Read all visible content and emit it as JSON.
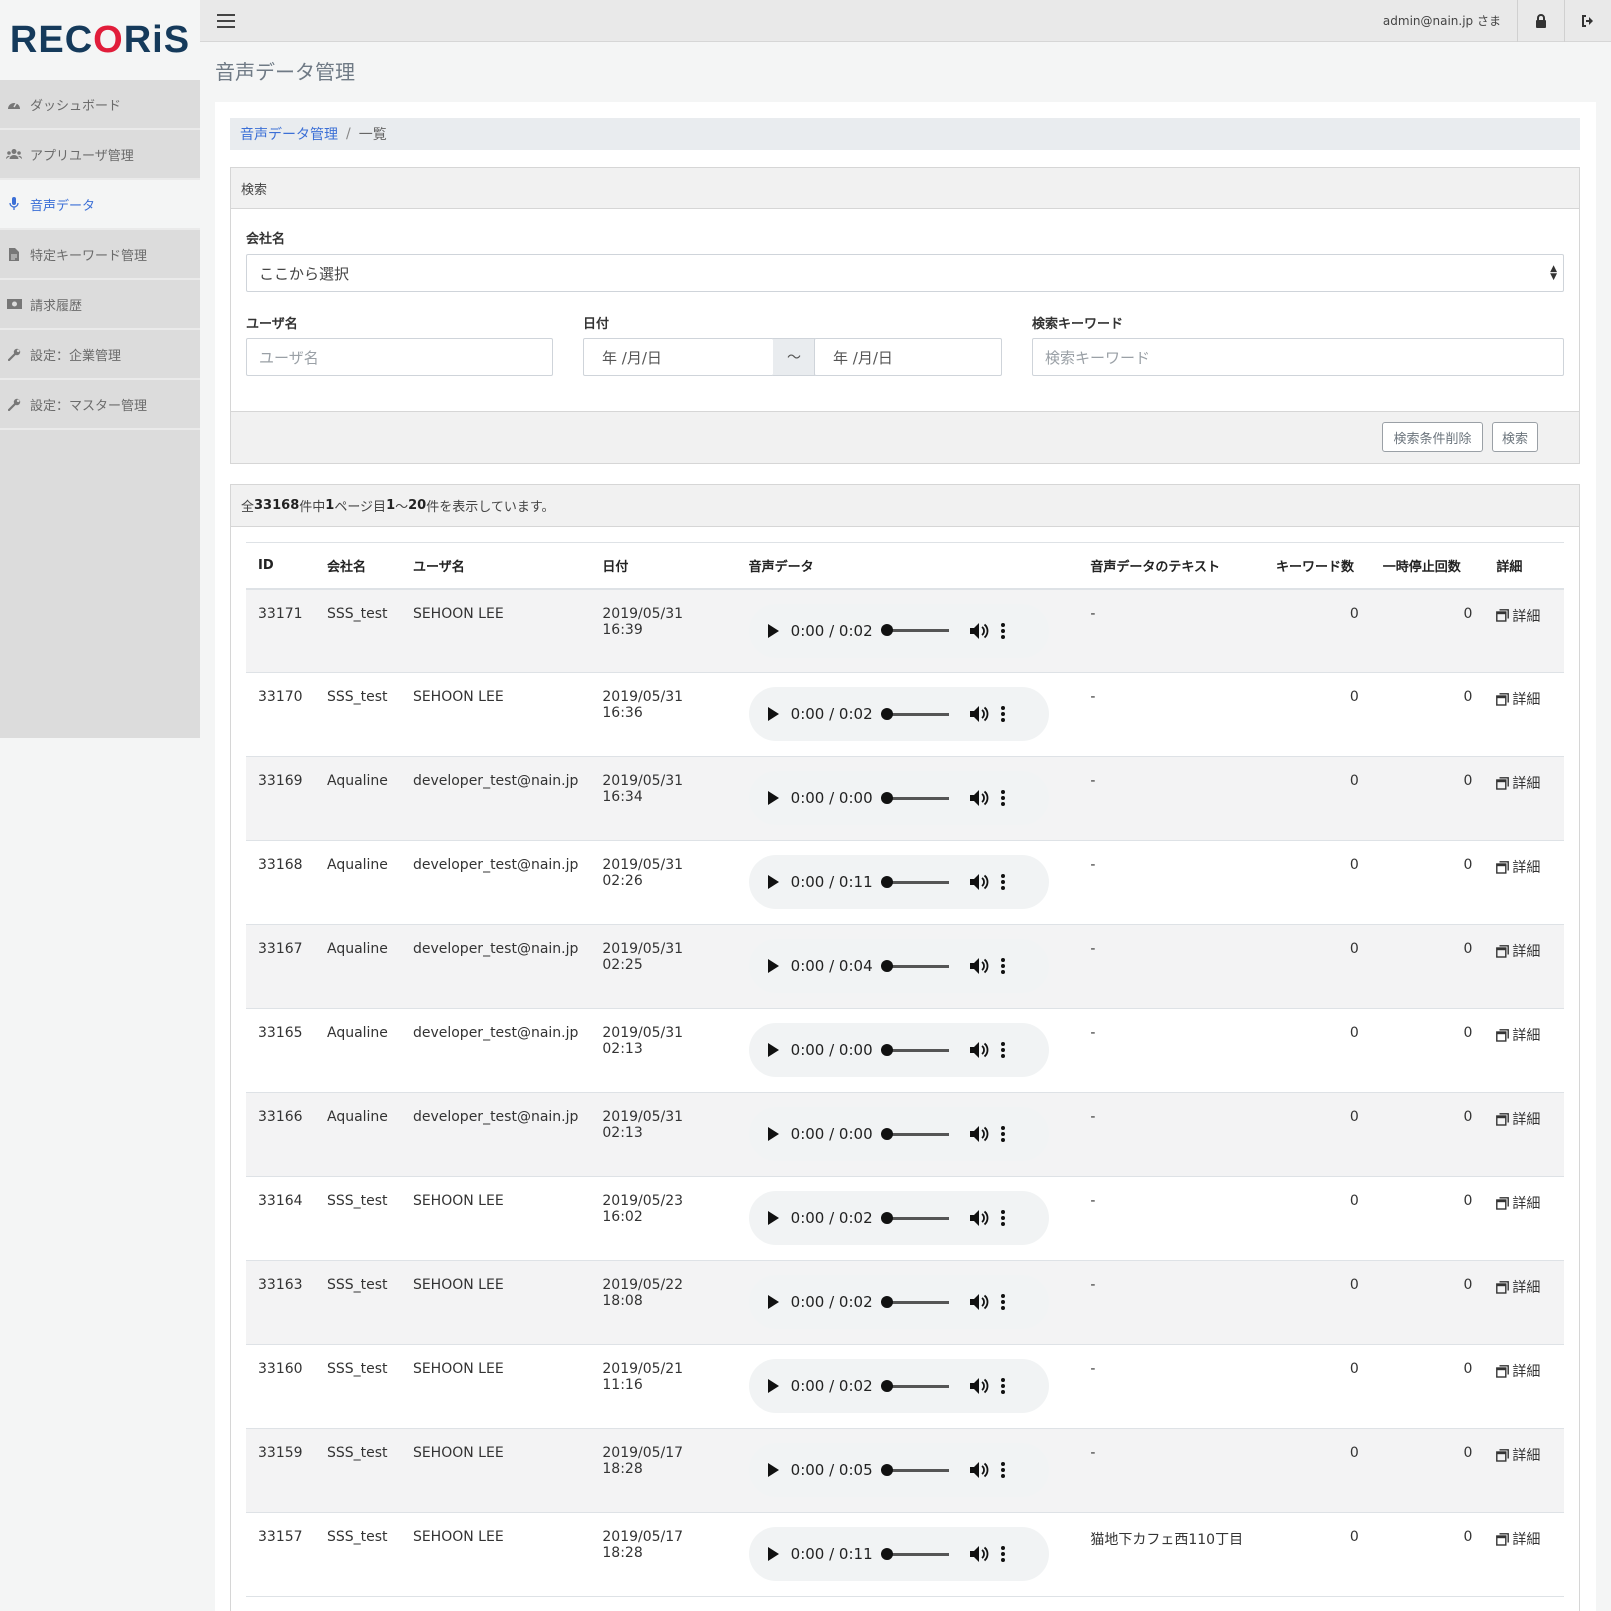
{
  "app": {
    "logo": "RECORiS"
  },
  "sidebar": {
    "items": [
      {
        "label": "ダッシュボード",
        "icon": "dashboard-icon",
        "active": false
      },
      {
        "label": "アプリユーザ管理",
        "icon": "users-icon",
        "active": false
      },
      {
        "label": "音声データ",
        "icon": "microphone-icon",
        "active": true
      },
      {
        "label": "特定キーワード管理",
        "icon": "document-icon",
        "active": false
      },
      {
        "label": "請求履歴",
        "icon": "money-icon",
        "active": false
      },
      {
        "label": "設定：企業管理",
        "icon": "wrench-icon",
        "active": false
      },
      {
        "label": "設定：マスター管理",
        "icon": "wrench-icon",
        "active": false
      }
    ]
  },
  "topbar": {
    "user": "admin@nain.jp さま"
  },
  "page": {
    "title": "音声データ管理"
  },
  "breadcrumb": {
    "parent": "音声データ管理",
    "separator": "/",
    "current": "一覧"
  },
  "search": {
    "header": "検索",
    "company_label": "会社名",
    "company_value": "ここから選択",
    "user_label": "ユーザ名",
    "user_placeholder": "ユーザ名",
    "date_label": "日付",
    "date_from": "年 /月/日",
    "date_sep": "〜",
    "date_to": "年 /月/日",
    "keyword_label": "検索キーワード",
    "keyword_placeholder": "検索キーワード",
    "clear_button": "検索条件削除",
    "search_button": "検索"
  },
  "summary": {
    "prefix": "全",
    "total": "33168",
    "mid1": "件中",
    "page": "1",
    "mid2": "ページ目",
    "from": "1",
    "range_sep": "〜",
    "to": "20",
    "suffix": "件を表示しています。"
  },
  "table": {
    "columns": [
      "ID",
      "会社名",
      "ユーザ名",
      "日付",
      "音声データ",
      "音声データのテキスト",
      "キーワード数",
      "一時停止回数",
      "詳細"
    ],
    "detail_label": "詳細",
    "rows": [
      {
        "id": "33171",
        "company": "SSS_test",
        "user": "SEHOON LEE",
        "date": "2019/05/31 16:39",
        "audio": "0:00 / 0:02",
        "text": "-",
        "keywords": "0",
        "pauses": "0"
      },
      {
        "id": "33170",
        "company": "SSS_test",
        "user": "SEHOON LEE",
        "date": "2019/05/31 16:36",
        "audio": "0:00 / 0:02",
        "text": "-",
        "keywords": "0",
        "pauses": "0"
      },
      {
        "id": "33169",
        "company": "Aqualine",
        "user": "developer_test@nain.jp",
        "date": "2019/05/31 16:34",
        "audio": "0:00 / 0:00",
        "text": "-",
        "keywords": "0",
        "pauses": "0"
      },
      {
        "id": "33168",
        "company": "Aqualine",
        "user": "developer_test@nain.jp",
        "date": "2019/05/31 02:26",
        "audio": "0:00 / 0:11",
        "text": "-",
        "keywords": "0",
        "pauses": "0"
      },
      {
        "id": "33167",
        "company": "Aqualine",
        "user": "developer_test@nain.jp",
        "date": "2019/05/31 02:25",
        "audio": "0:00 / 0:04",
        "text": "-",
        "keywords": "0",
        "pauses": "0"
      },
      {
        "id": "33165",
        "company": "Aqualine",
        "user": "developer_test@nain.jp",
        "date": "2019/05/31 02:13",
        "audio": "0:00 / 0:00",
        "text": "-",
        "keywords": "0",
        "pauses": "0"
      },
      {
        "id": "33166",
        "company": "Aqualine",
        "user": "developer_test@nain.jp",
        "date": "2019/05/31 02:13",
        "audio": "0:00 / 0:00",
        "text": "-",
        "keywords": "0",
        "pauses": "0"
      },
      {
        "id": "33164",
        "company": "SSS_test",
        "user": "SEHOON LEE",
        "date": "2019/05/23 16:02",
        "audio": "0:00 / 0:02",
        "text": "-",
        "keywords": "0",
        "pauses": "0"
      },
      {
        "id": "33163",
        "company": "SSS_test",
        "user": "SEHOON LEE",
        "date": "2019/05/22 18:08",
        "audio": "0:00 / 0:02",
        "text": "-",
        "keywords": "0",
        "pauses": "0"
      },
      {
        "id": "33160",
        "company": "SSS_test",
        "user": "SEHOON LEE",
        "date": "2019/05/21 11:16",
        "audio": "0:00 / 0:02",
        "text": "-",
        "keywords": "0",
        "pauses": "0"
      },
      {
        "id": "33159",
        "company": "SSS_test",
        "user": "SEHOON LEE",
        "date": "2019/05/17 18:28",
        "audio": "0:00 / 0:05",
        "text": "-",
        "keywords": "0",
        "pauses": "0"
      },
      {
        "id": "33157",
        "company": "SSS_test",
        "user": "SEHOON LEE",
        "date": "2019/05/17 18:28",
        "audio": "0:00 / 0:11",
        "text": "猫地下カフェ西110丁目",
        "keywords": "0",
        "pauses": "0"
      }
    ]
  },
  "colors": {
    "accent": "#3b6fd6",
    "logo_navy": "#153a5b",
    "logo_red": "#e11d3a"
  }
}
